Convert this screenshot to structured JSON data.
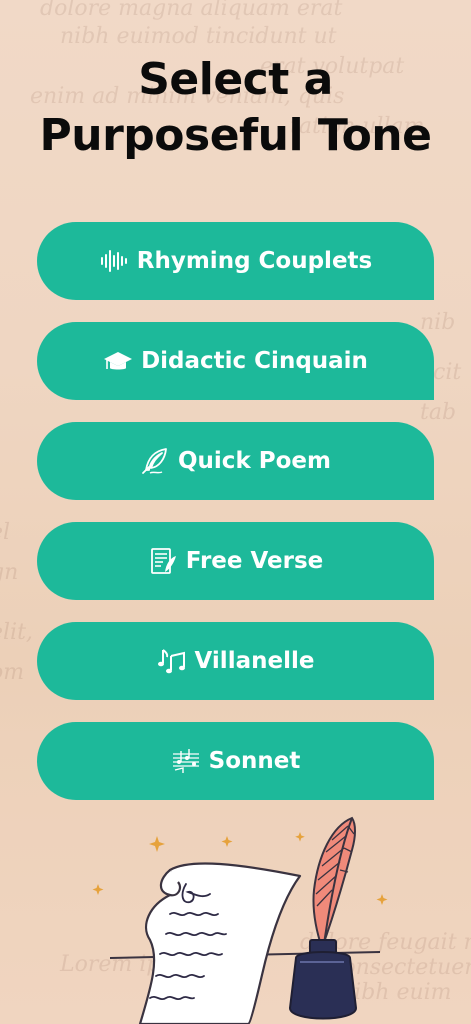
{
  "header": {
    "title_line1": "Select a",
    "title_line2": "Purposeful Tone"
  },
  "options": [
    {
      "label": "Rhyming Couplets",
      "icon": "soundwave-icon"
    },
    {
      "label": "Didactic Cinquain",
      "icon": "graduation-cap-icon"
    },
    {
      "label": "Quick Poem",
      "icon": "feather-icon"
    },
    {
      "label": "Free Verse",
      "icon": "document-quill-icon"
    },
    {
      "label": "Villanelle",
      "icon": "music-notes-icon"
    },
    {
      "label": "Sonnet",
      "icon": "sheet-music-icon"
    }
  ],
  "colors": {
    "button": "#1db99a",
    "title": "#0b0b0b",
    "background": "#f1d9c7"
  }
}
